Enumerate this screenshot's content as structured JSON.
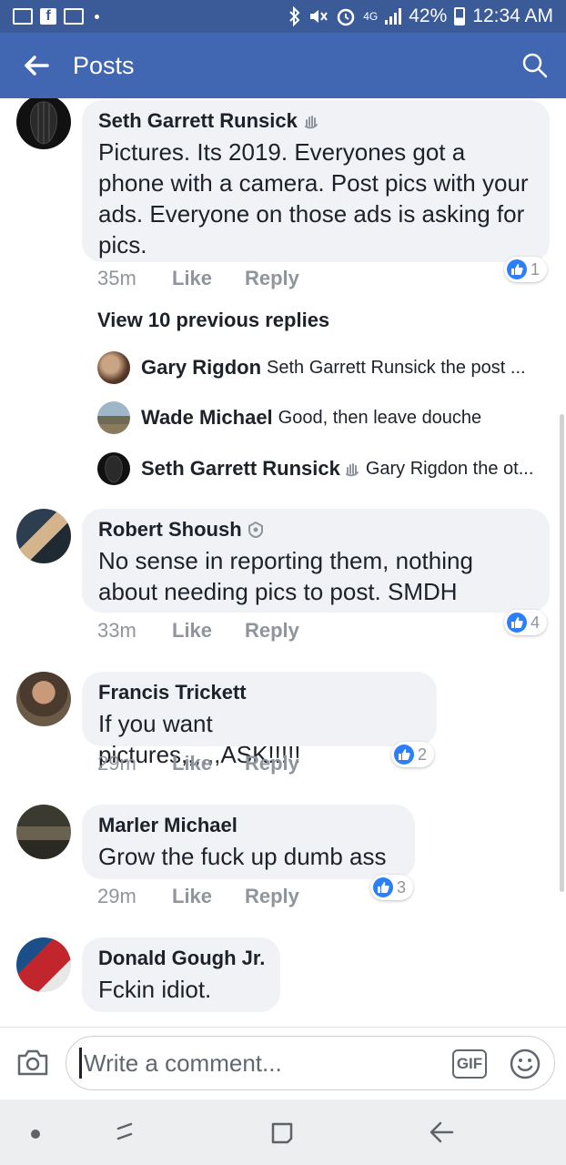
{
  "status_bar": {
    "battery": "42%",
    "time": "12:34 AM",
    "network": "4G"
  },
  "header": {
    "title": "Posts"
  },
  "comments": [
    {
      "author": "Seth Garrett Runsick",
      "text": "Pictures. Its 2019. Everyones got a phone with a camera. Post pics with your ads. Everyone on those ads is asking for pics.",
      "time": "35m",
      "like": "Like",
      "reply": "Reply",
      "reactions": "1"
    },
    {
      "author": "Robert Shoush",
      "text": "No sense in reporting them,   nothing about needing pics to post.  SMDH",
      "time": "33m",
      "like": "Like",
      "reply": "Reply",
      "reactions": "4"
    },
    {
      "author": "Francis Trickett",
      "text": "If you want pictures,,,,,,ASK!!!!!",
      "time": "29m",
      "like": "Like",
      "reply": "Reply",
      "reactions": "2"
    },
    {
      "author": "Marler Michael",
      "text": "Grow the fuck up dumb ass",
      "time": "29m",
      "like": "Like",
      "reply": "Reply",
      "reactions": "3"
    },
    {
      "author": "Donald Gough Jr.",
      "text": "Fckin idiot."
    }
  ],
  "view_previous": "View 10 previous replies",
  "replies": [
    {
      "author": "Gary Rigdon",
      "text": "Seth Garrett Runsick the post ..."
    },
    {
      "author": "Wade Michael",
      "text": "Good, then leave douche"
    },
    {
      "author": "Seth Garrett Runsick",
      "text": "Gary Rigdon the ot..."
    }
  ],
  "composer": {
    "placeholder": "Write a comment...",
    "gif_label": "GIF"
  },
  "colors": {
    "header_bg": "#4267b2",
    "status_bg": "#3b5a98",
    "bubble_bg": "#f1f2f6",
    "like_blue": "#2d7ff9"
  }
}
